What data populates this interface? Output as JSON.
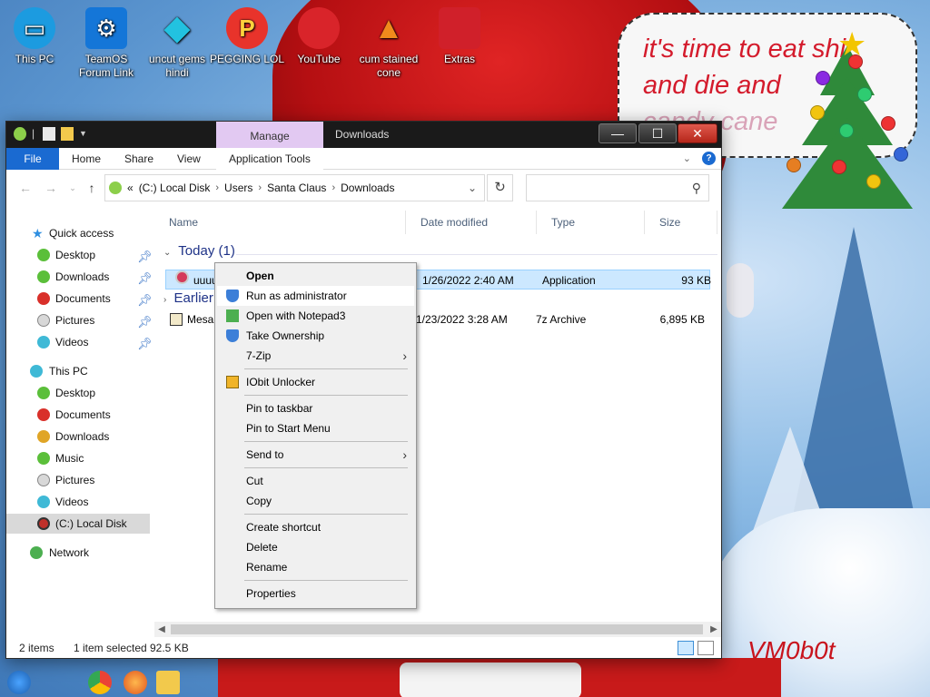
{
  "desktop": {
    "icons": [
      {
        "label": "This PC",
        "icon": "monitor-icon",
        "color": "#1c9be0"
      },
      {
        "label": "TeamOS Forum Link",
        "icon": "gear-icon",
        "color": "#1476d8"
      },
      {
        "label": "uncut gems hindi",
        "icon": "diamond-icon",
        "color": "#22c2e0"
      },
      {
        "label": "PEGGING LOL",
        "icon": "letter-p-icon",
        "color": "#e8332b"
      },
      {
        "label": "YouTube",
        "icon": "angry-bird-icon",
        "color": "#d9242a"
      },
      {
        "label": "cum stained cone",
        "icon": "traffic-cone-icon",
        "color": "#f08a1c"
      },
      {
        "label": "Extras",
        "icon": "gift-icon",
        "color": "#d0202a"
      }
    ],
    "speech_bubble": {
      "line1": "it's time to eat shit",
      "line2": "and die and",
      "line3": "candy cane"
    },
    "signature": "VM0b0t"
  },
  "window": {
    "context_tab": "Manage",
    "title": "Downloads",
    "controls": {
      "minimize": "—",
      "maximize": "☐",
      "close": "✕"
    },
    "ribbon_tabs": [
      "File",
      "Home",
      "Share",
      "View",
      "Application Tools"
    ],
    "address": {
      "overflow": "«",
      "crumbs": [
        "(C:) Local Disk",
        "Users",
        "Santa Claus",
        "Downloads"
      ]
    },
    "search": {
      "placeholder": ""
    },
    "nav": {
      "quick_access": "Quick access",
      "quick_items": [
        {
          "label": "Desktop",
          "pinned": true
        },
        {
          "label": "Downloads",
          "pinned": true
        },
        {
          "label": "Documents",
          "pinned": true
        },
        {
          "label": "Pictures",
          "pinned": true
        },
        {
          "label": "Videos",
          "pinned": true
        }
      ],
      "this_pc": "This PC",
      "pc_items": [
        "Desktop",
        "Documents",
        "Downloads",
        "Music",
        "Pictures",
        "Videos",
        "(C:) Local Disk"
      ],
      "network": "Network"
    },
    "columns": [
      "Name",
      "Date modified",
      "Type",
      "Size"
    ],
    "groups": [
      {
        "label": "Today (1)",
        "files": [
          {
            "name": "uuuu",
            "date": "1/26/2022 2:40 AM",
            "type": "Application",
            "size": "93 KB",
            "selected": true
          }
        ]
      },
      {
        "label": "Earlier",
        "files": [
          {
            "name": "Mesa",
            "date": "1/23/2022 3:28 AM",
            "type": "7z Archive",
            "size": "6,895 KB",
            "selected": false
          }
        ]
      }
    ],
    "status": {
      "count": "2 items",
      "selection": "1 item selected",
      "size": "92.5 KB"
    }
  },
  "context_menu": {
    "open": "Open",
    "run_as_admin": "Run as administrator",
    "open_notepad3": "Open with Notepad3",
    "take_ownership": "Take Ownership",
    "seven_zip": "7-Zip",
    "iobit": "IObit Unlocker",
    "pin_taskbar": "Pin to taskbar",
    "pin_start": "Pin to Start Menu",
    "send_to": "Send to",
    "cut": "Cut",
    "copy": "Copy",
    "create_shortcut": "Create shortcut",
    "delete": "Delete",
    "rename": "Rename",
    "properties": "Properties"
  }
}
